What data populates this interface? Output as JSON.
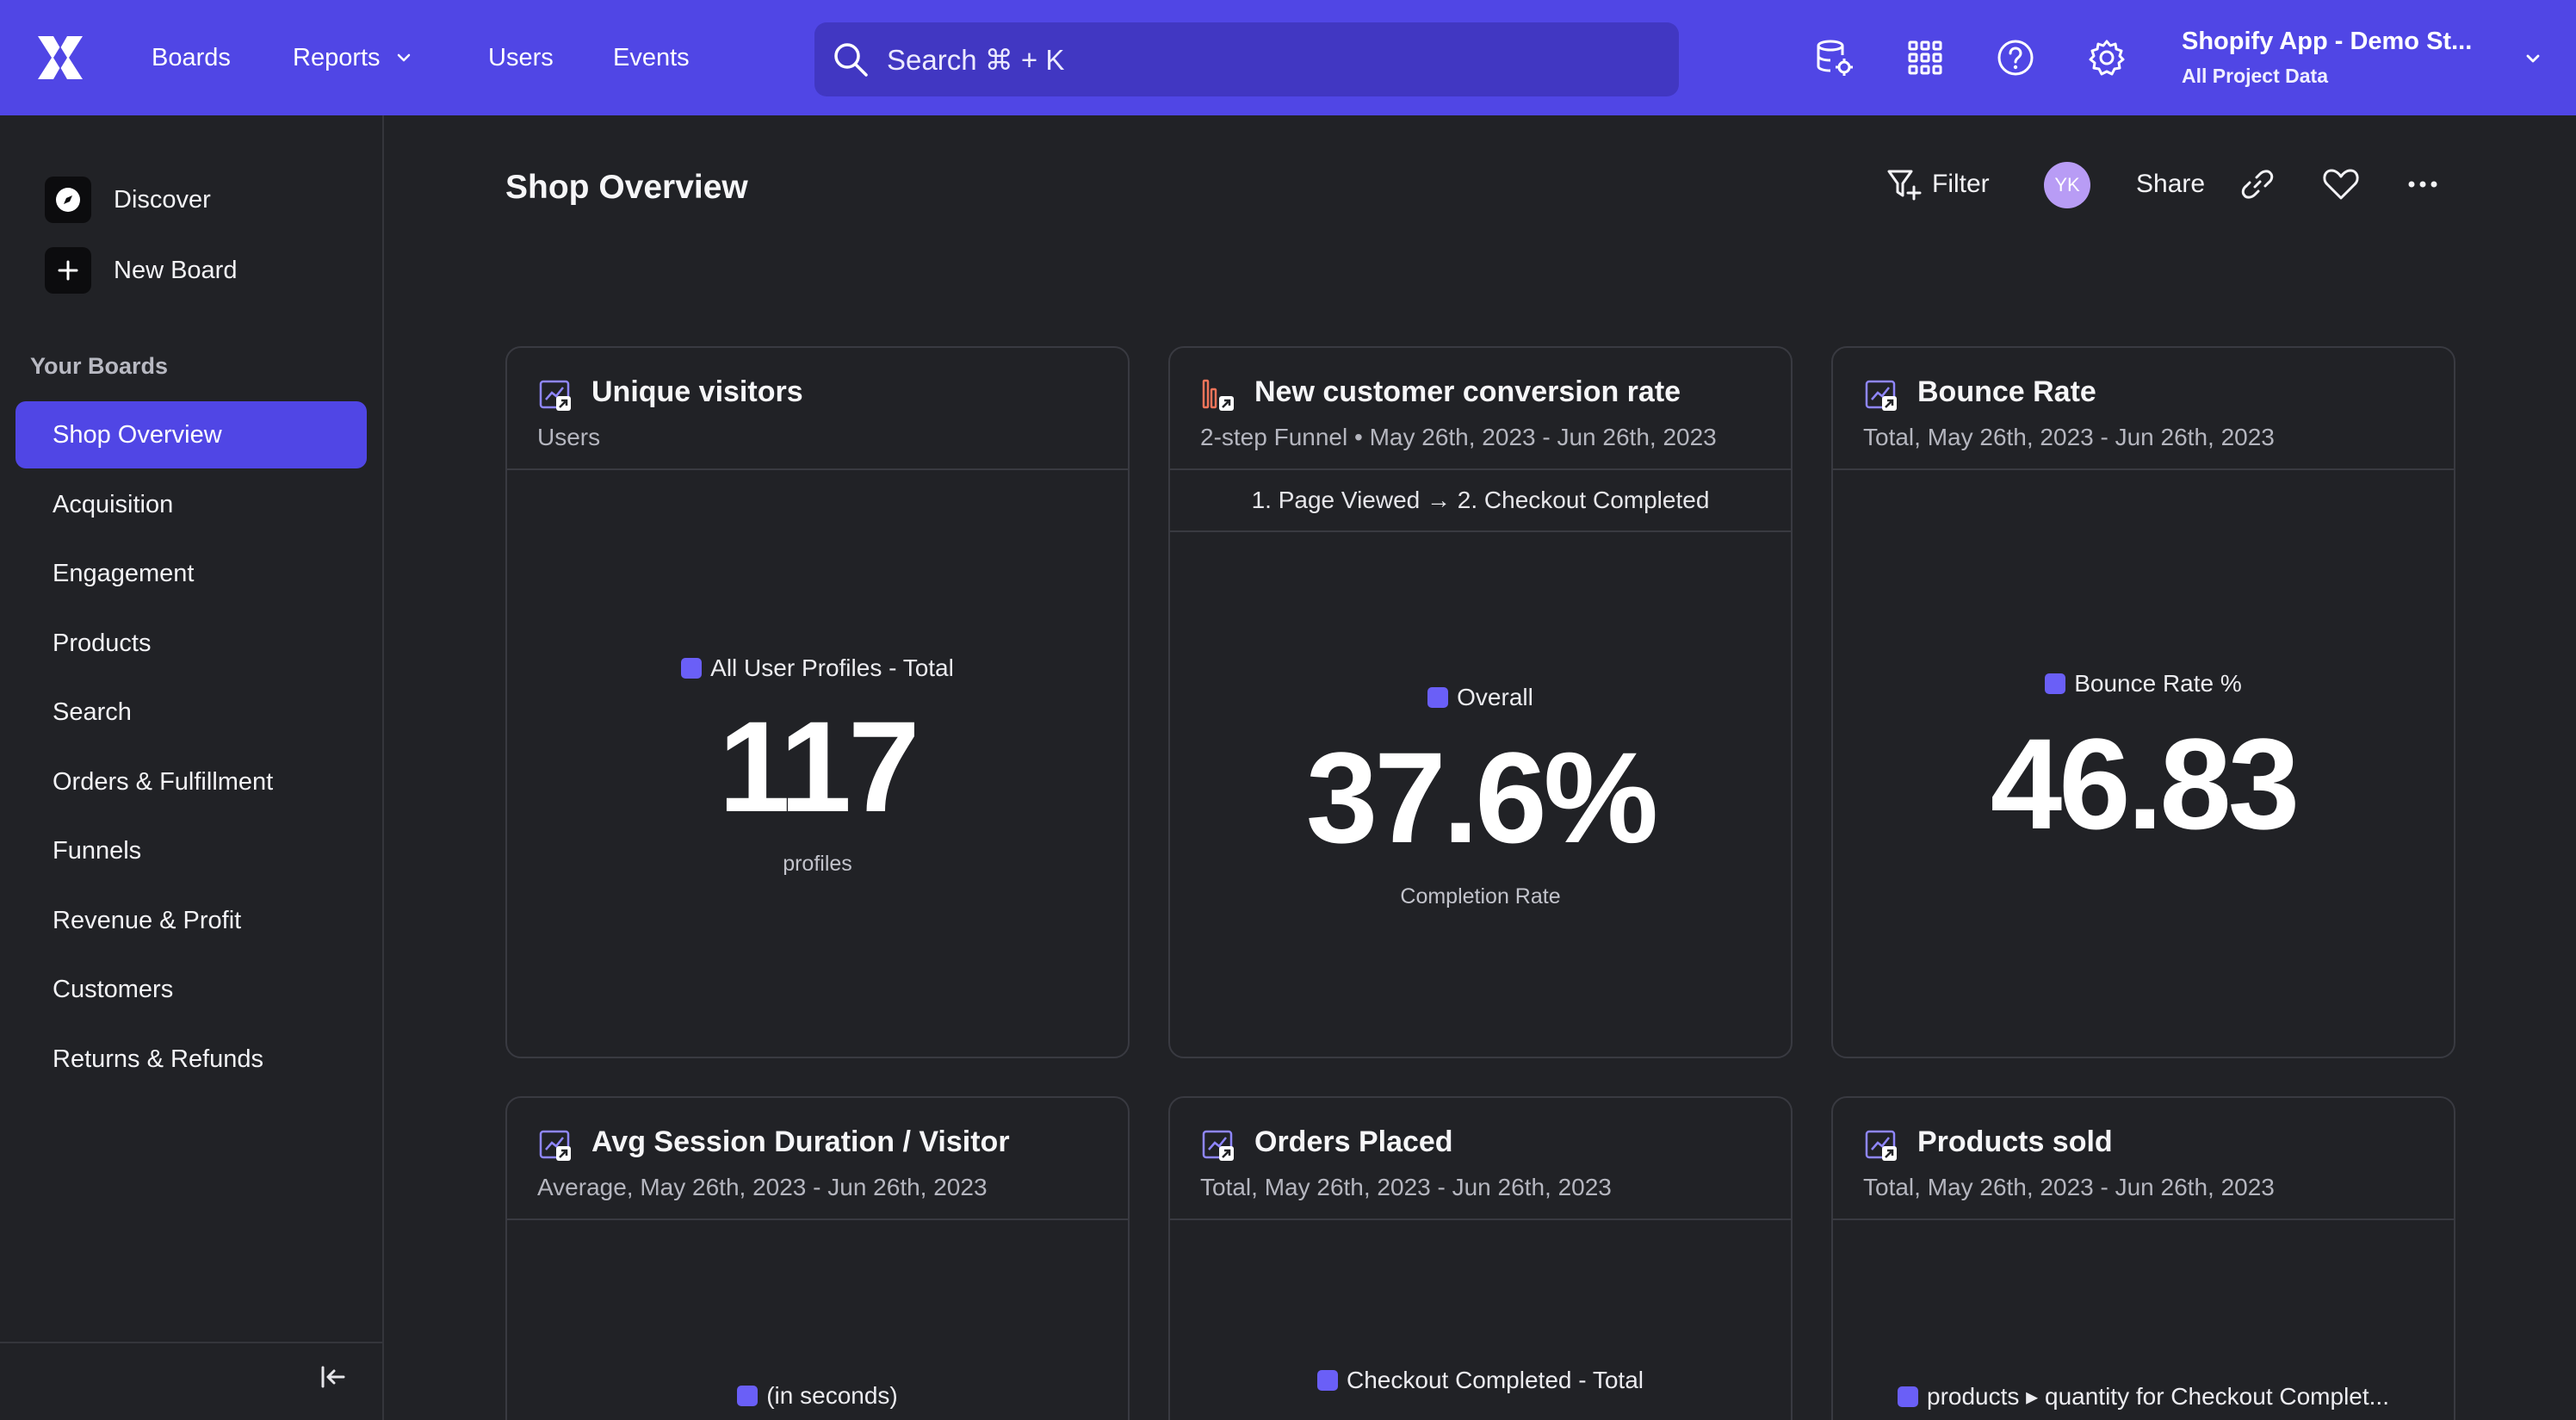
{
  "topnav": {
    "items": [
      {
        "label": "Boards"
      },
      {
        "label": "Reports"
      },
      {
        "label": "Users"
      },
      {
        "label": "Events"
      }
    ],
    "search_label": "Search ⌘ + K",
    "icons": [
      "data-management-icon",
      "apps-grid-icon",
      "help-icon",
      "settings-icon"
    ],
    "project": {
      "name": "Shopify App - Demo St...",
      "subtitle": "All Project Data"
    }
  },
  "sidebar": {
    "actions": [
      {
        "label": "Discover",
        "icon": "compass-icon"
      },
      {
        "label": "New Board",
        "icon": "plus-icon"
      }
    ],
    "heading": "Your Boards",
    "boards": [
      {
        "label": "Shop Overview",
        "active": true
      },
      {
        "label": "Acquisition"
      },
      {
        "label": "Engagement"
      },
      {
        "label": "Products"
      },
      {
        "label": "Search"
      },
      {
        "label": "Orders & Fulfillment"
      },
      {
        "label": "Funnels"
      },
      {
        "label": "Revenue & Profit"
      },
      {
        "label": "Customers"
      },
      {
        "label": "Returns & Refunds"
      }
    ]
  },
  "board": {
    "title": "Shop Overview",
    "toolbar": {
      "filter_label": "Filter",
      "avatar_initials": "YK",
      "share_label": "Share"
    }
  },
  "cards": [
    {
      "title": "Unique visitors",
      "subtitle": "Users",
      "legend": "All User Profiles - Total",
      "value": "117",
      "unit": "profiles"
    },
    {
      "title": "New customer conversion rate",
      "subtitle": "2-step Funnel • May 26th, 2023 - Jun 26th, 2023",
      "steps": "1. Page Viewed → 2. Checkout Completed",
      "legend": "Overall",
      "value": "37.6%",
      "unit": "Completion Rate"
    },
    {
      "title": "Bounce Rate",
      "subtitle": "Total, May 26th, 2023 - Jun 26th, 2023",
      "legend": "Bounce Rate %",
      "value": "46.83"
    },
    {
      "title": "Avg Session Duration / Visitor",
      "subtitle": "Average, May 26th, 2023 - Jun 26th, 2023",
      "legend": "(in seconds)"
    },
    {
      "title": "Orders Placed",
      "subtitle": "Total, May 26th, 2023 - Jun 26th, 2023",
      "legend": "Checkout Completed - Total"
    },
    {
      "title": "Products sold",
      "subtitle": "Total, May 26th, 2023 - Jun 26th, 2023",
      "legend": "products ▸ quantity for Checkout Complet..."
    }
  ],
  "colors": {
    "brand": "#5046e5",
    "background": "#212226",
    "series": "#6a5ff7",
    "avatar": "#b89cf5"
  }
}
